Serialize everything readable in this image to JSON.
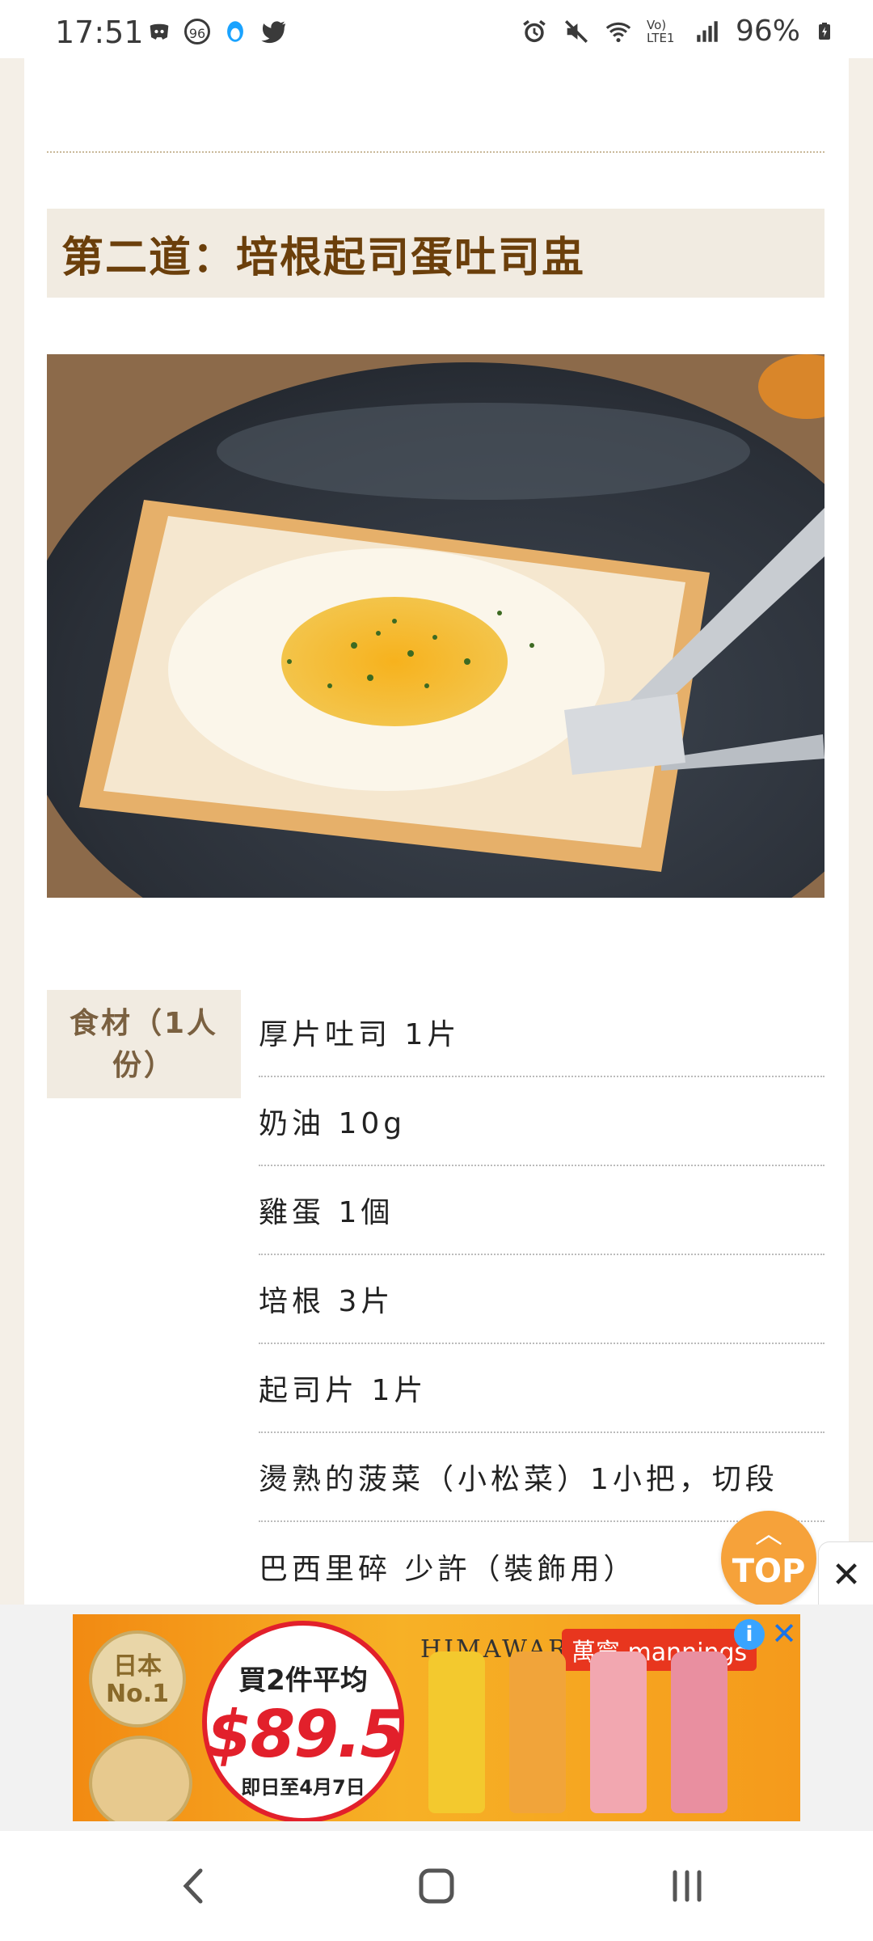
{
  "status_bar": {
    "time": "17:51",
    "notification_count": "96",
    "battery": "96%",
    "network_label": "Vo) LTE1"
  },
  "article": {
    "heading": "第二道：培根起司蛋吐司盅",
    "ingredients_label": "食材（1人份）",
    "ingredients": [
      "厚片吐司 1片",
      "奶油 10g",
      "雞蛋 1個",
      "培根 3片",
      "起司片 1片",
      "燙熟的菠菜（小松菜）1小把，切段",
      "巴西里碎 少許（裝飾用）"
    ]
  },
  "top_button": {
    "label": "TOP"
  },
  "ad": {
    "badge": "日本No.1",
    "line1": "買2件平均",
    "price": "$89.5",
    "line3": "即日至4月7日",
    "brand": "HIMAWARI",
    "store": "萬寧 mannings",
    "info_glyph": "i",
    "close_glyph": "✕"
  },
  "colors": {
    "heading_text": "#6b3f0b",
    "heading_bg": "#f1ebe1",
    "top_button": "#f6a23a",
    "page_side": "#f4efe7"
  }
}
